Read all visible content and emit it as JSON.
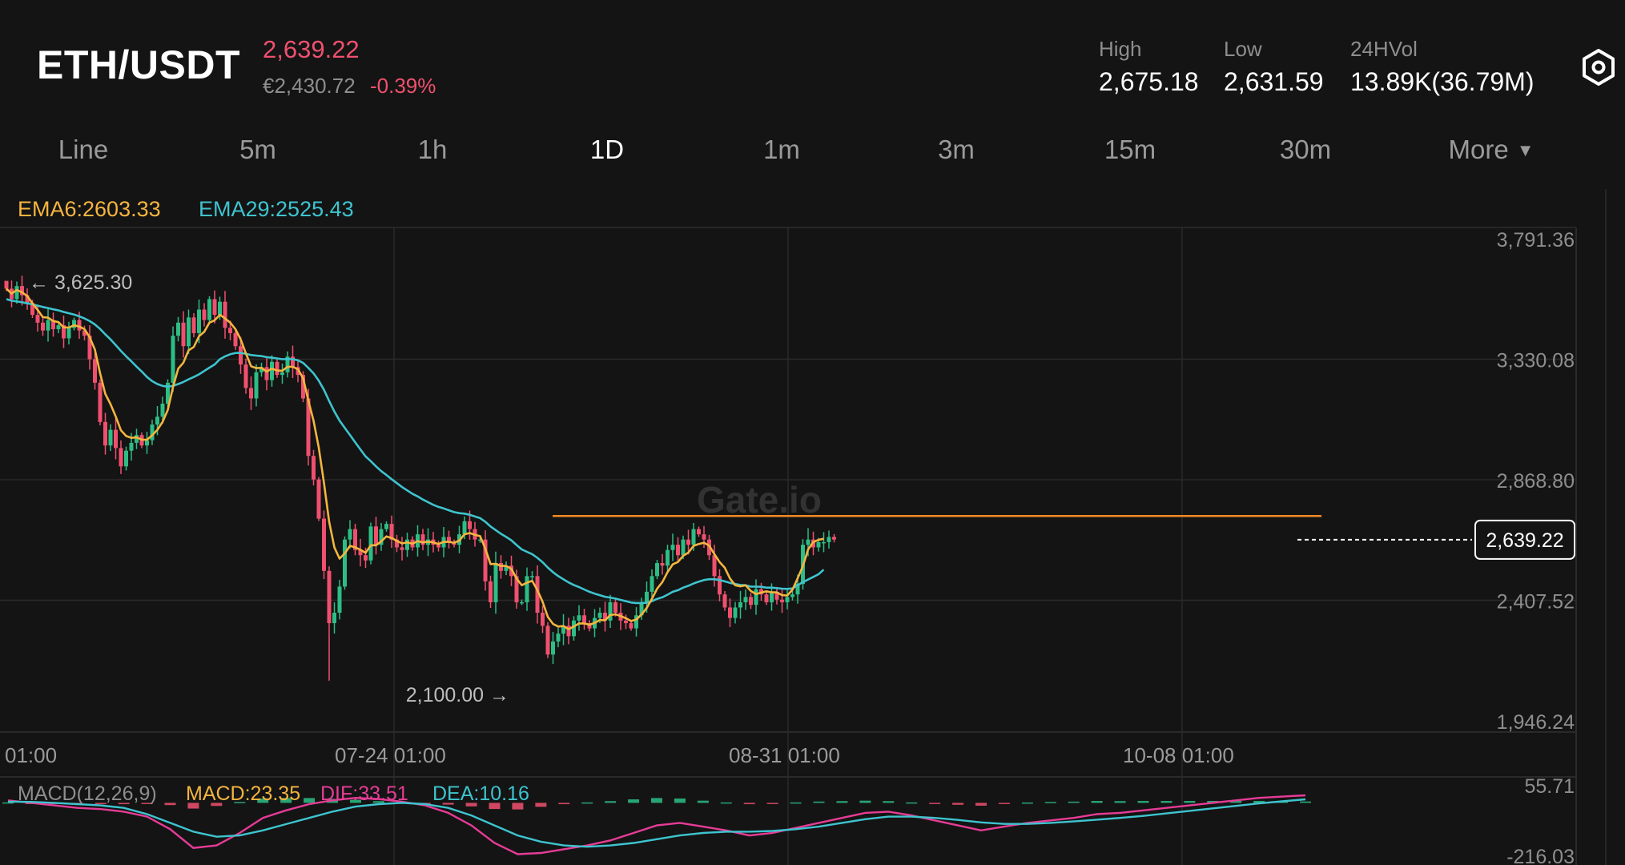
{
  "header": {
    "pair": "ETH/USDT",
    "last_price": "2,639.22",
    "fiat_price": "€2,430.72",
    "change_pct": "-0.39%",
    "high_label": "High",
    "high_value": "2,675.18",
    "low_label": "Low",
    "low_value": "2,631.59",
    "vol_label": "24HVol",
    "vol_value": "13.89K(36.79M)",
    "settings_icon": "settings-hex-icon"
  },
  "tabs": [
    {
      "label": "Line",
      "active": false
    },
    {
      "label": "5m",
      "active": false
    },
    {
      "label": "1h",
      "active": false
    },
    {
      "label": "1D",
      "active": true
    },
    {
      "label": "1m",
      "active": false
    },
    {
      "label": "3m",
      "active": false
    },
    {
      "label": "15m",
      "active": false
    },
    {
      "label": "30m",
      "active": false
    }
  ],
  "more_tab": {
    "label": "More",
    "icon": "caret-down-icon"
  },
  "indicators": {
    "ema6_label": "EMA6:2603.33",
    "ema29_label": "EMA29:2525.43",
    "macd_label": "MACD(12,26,9)",
    "macd_value": "MACD:23.35",
    "dif_value": "DIF:33.51",
    "dea_value": "DEA:10.16"
  },
  "colors": {
    "up": "#2dbd85",
    "down": "#f0506e",
    "ema6": "#f5b53f",
    "ema29": "#3ec4cf",
    "resistance_line": "#f08a24",
    "dif": "#e63c96",
    "dea": "#3ec4cf"
  },
  "watermark": "Gate.io",
  "chart_data": {
    "type": "candlestick",
    "y_ticks": [
      "3,791.36",
      "3,330.08",
      "2,868.80",
      "2,407.52",
      "1,946.24"
    ],
    "y_tick_values": [
      3791.36,
      3330.08,
      2868.8,
      2407.52,
      1946.24
    ],
    "x_ticks": [
      "01:00",
      "07-24 01:00",
      "08-31 01:00",
      "10-08 01:00"
    ],
    "max_label": "← 3,625.30",
    "min_label": "2,100.00 →",
    "max_value": 3625.3,
    "min_value": 2100.0,
    "current_price": 2639.22,
    "current_price_label": "2,639.22",
    "resistance_level": 2730,
    "closes": [
      3600,
      3560,
      3610,
      3575,
      3545,
      3500,
      3470,
      3440,
      3480,
      3445,
      3460,
      3410,
      3450,
      3480,
      3440,
      3420,
      3330,
      3240,
      3090,
      3000,
      3060,
      2990,
      2920,
      2980,
      3010,
      3040,
      3000,
      3020,
      3080,
      3110,
      3160,
      3240,
      3420,
      3470,
      3380,
      3490,
      3430,
      3520,
      3480,
      3560,
      3500,
      3550,
      3450,
      3430,
      3380,
      3310,
      3220,
      3180,
      3280,
      3300,
      3250,
      3320,
      3270,
      3280,
      3340,
      3300,
      3270,
      3180,
      2960,
      2870,
      2720,
      2520,
      2320,
      2360,
      2460,
      2640,
      2680,
      2600,
      2580,
      2560,
      2690,
      2620,
      2680,
      2700,
      2640,
      2610,
      2600,
      2640,
      2610,
      2660,
      2620,
      2640,
      2620,
      2610,
      2650,
      2630,
      2620,
      2660,
      2710,
      2680,
      2640,
      2640,
      2480,
      2400,
      2550,
      2520,
      2540,
      2500,
      2400,
      2400,
      2500,
      2500,
      2360,
      2310,
      2200,
      2250,
      2280,
      2310,
      2270,
      2330,
      2350,
      2320,
      2300,
      2340,
      2360,
      2330,
      2400,
      2360,
      2330,
      2320,
      2300,
      2350,
      2400,
      2440,
      2500,
      2550,
      2540,
      2600,
      2620,
      2580,
      2640,
      2620,
      2680,
      2660,
      2640,
      2580,
      2500,
      2430,
      2380,
      2340,
      2380,
      2400,
      2420,
      2390,
      2450,
      2430,
      2400,
      2440,
      2410,
      2400,
      2420,
      2430,
      2470,
      2620,
      2640,
      2610,
      2630,
      2630,
      2650,
      2640
    ],
    "ema6": [
      3600,
      3581,
      3595,
      3586,
      3572,
      3544,
      3519,
      3491,
      3489,
      3476,
      3472,
      3452,
      3451,
      3460,
      3455,
      3445,
      3414,
      3367,
      3276,
      3197,
      3158,
      3111,
      3058,
      3036,
      3029,
      3031,
      3022,
      3022,
      3039,
      3060,
      3090,
      3136,
      3223,
      3294,
      3317,
      3364,
      3377,
      3418,
      3435,
      3470,
      3479,
      3500,
      3486,
      3470,
      3445,
      3406,
      3352,
      3303,
      3296,
      3297,
      3283,
      3294,
      3287,
      3286,
      3301,
      3301,
      3292,
      3257,
      3172,
      3095,
      2992,
      2857,
      2708,
      2610,
      2567,
      2587,
      2616,
      2610,
      2601,
      2589,
      2618,
      2618,
      2633,
      2652,
      2646,
      2635,
      2625,
      2629,
      2624,
      2634,
      2629,
      2632,
      2629,
      2623,
      2631,
      2631,
      2628,
      2636,
      2660,
      2665,
      2658,
      2653,
      2605,
      2546,
      2547,
      2539,
      2539,
      2528,
      2491,
      2465,
      2475,
      2482,
      2446,
      2402,
      2344,
      2317,
      2307,
      2309,
      2297,
      2307,
      2319,
      2319,
      2314,
      2321,
      2332,
      2331,
      2351,
      2354,
      2347,
      2339,
      2328,
      2334,
      2353,
      2378,
      2413,
      2452,
      2477,
      2515,
      2545,
      2554,
      2578,
      2590,
      2616,
      2623,
      2628,
      2617,
      2584,
      2554,
      2532,
      2491,
      2465,
      2461,
      2465,
      2443,
      2431,
      2437,
      2442,
      2438,
      2438,
      2427,
      2426,
      2448,
      2492,
      2538,
      2602,
      2630,
      2639,
      2643
    ],
    "ema29": [
      3560,
      3554,
      3551,
      3548,
      3544,
      3540,
      3535,
      3530,
      3526,
      3521,
      3517,
      3511,
      3506,
      3501,
      3494,
      3486,
      3476,
      3463,
      3446,
      3425,
      3406,
      3384,
      3362,
      3341,
      3322,
      3302,
      3283,
      3262,
      3246,
      3235,
      3228,
      3225,
      3228,
      3235,
      3243,
      3253,
      3262,
      3272,
      3285,
      3298,
      3310,
      3330,
      3341,
      3349,
      3354,
      3354,
      3351,
      3346,
      3344,
      3342,
      3338,
      3336,
      3333,
      3330,
      3331,
      3330,
      3326,
      3316,
      3297,
      3276,
      3248,
      3213,
      3170,
      3130,
      3095,
      3067,
      3040,
      3012,
      2985,
      2958,
      2940,
      2920,
      2902,
      2887,
      2871,
      2856,
      2841,
      2828,
      2815,
      2805,
      2793,
      2783,
      2773,
      2765,
      2759,
      2752,
      2745,
      2741,
      2739,
      2735,
      2728,
      2722,
      2708,
      2690,
      2676,
      2662,
      2650,
      2637,
      2619,
      2602,
      2593,
      2584,
      2570,
      2553,
      2533,
      2515,
      2500,
      2488,
      2476,
      2466,
      2458,
      2449,
      2440,
      2433,
      2427,
      2421,
      2418,
      2414,
      2409,
      2404,
      2399,
      2397,
      2397,
      2398,
      2404,
      2413,
      2419,
      2429,
      2440,
      2446,
      2456,
      2463,
      2472,
      2479,
      2485,
      2488,
      2488,
      2485,
      2480,
      2474,
      2470,
      2466,
      2465,
      2460,
      2460,
      2459,
      2456,
      2456,
      2454,
      2452,
      2451,
      2453,
      2465,
      2477,
      2487,
      2497,
      2507,
      2525
    ],
    "macd_range": {
      "top_label": "55.71",
      "bottom_label": "-216.03",
      "top": 55.71,
      "bottom": -216.03
    },
    "dif": [
      10,
      0,
      -10,
      -20,
      -25,
      -35,
      -55,
      -105,
      -180,
      -170,
      -120,
      -60,
      -30,
      -5,
      10,
      20,
      15,
      5,
      -10,
      -40,
      -90,
      -160,
      -205,
      -200,
      -185,
      -170,
      -150,
      -120,
      -90,
      -80,
      -95,
      -110,
      -130,
      -120,
      -100,
      -80,
      -60,
      -40,
      -35,
      -50,
      -70,
      -90,
      -110,
      -95,
      -80,
      -70,
      -60,
      -45,
      -40,
      -30,
      -20,
      -10,
      0,
      10,
      20,
      25,
      30
    ],
    "dea": [
      5,
      4,
      0,
      -5,
      -10,
      -20,
      -45,
      -80,
      -115,
      -135,
      -130,
      -110,
      -85,
      -60,
      -35,
      -15,
      -5,
      0,
      -5,
      -20,
      -50,
      -90,
      -130,
      -155,
      -170,
      -175,
      -170,
      -160,
      -145,
      -130,
      -120,
      -115,
      -115,
      -112,
      -105,
      -95,
      -80,
      -65,
      -55,
      -55,
      -60,
      -68,
      -78,
      -84,
      -84,
      -80,
      -74,
      -67,
      -60,
      -52,
      -42,
      -32,
      -22,
      -12,
      -2,
      6,
      14
    ]
  }
}
